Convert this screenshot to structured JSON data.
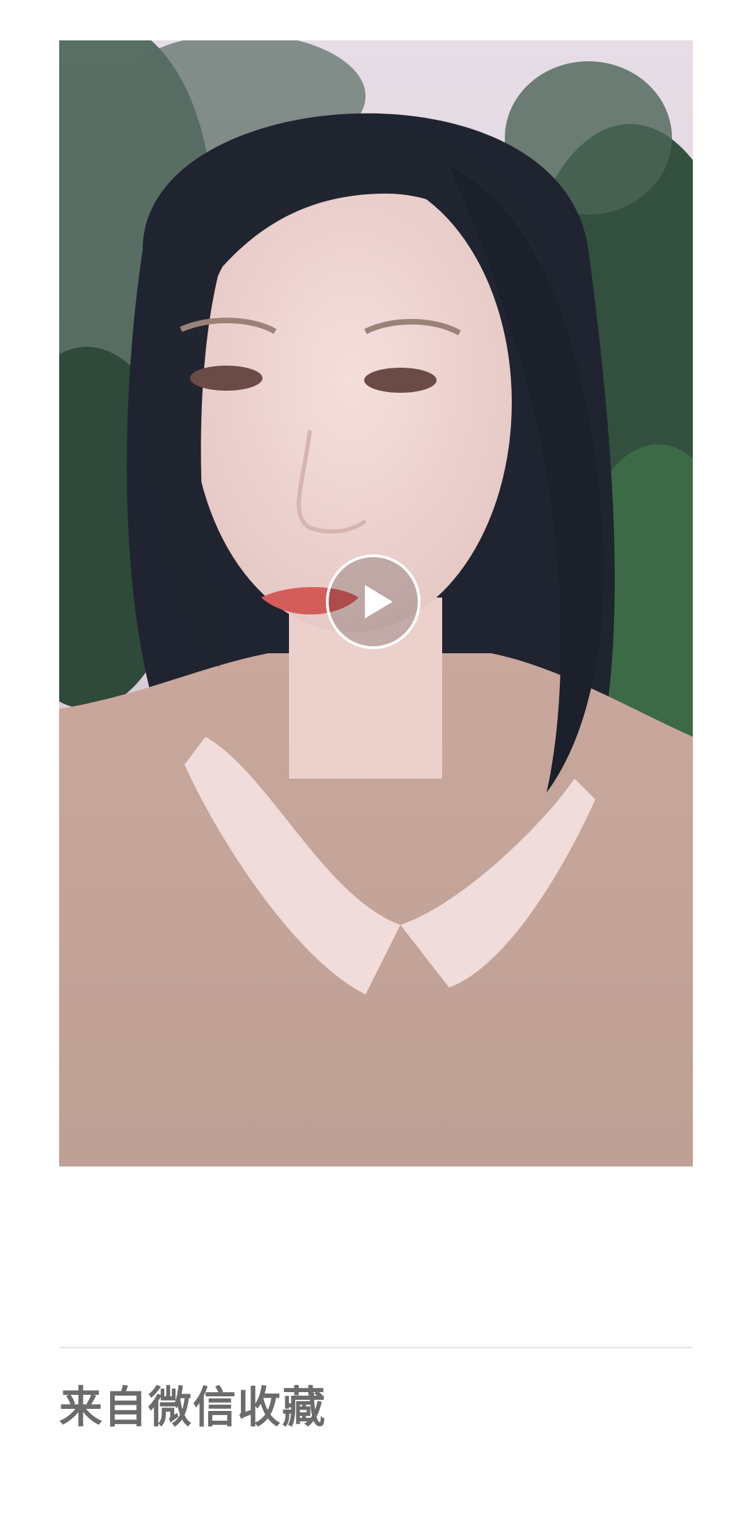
{
  "video": {
    "thumbnail_icon": "video-thumbnail",
    "play_icon": "play-icon"
  },
  "footer": {
    "source_label": "来自微信收藏"
  },
  "colors": {
    "background": "#ffffff",
    "divider": "#e6e6e6",
    "label_text": "#6b6b6b",
    "play_ring": "#ffffff"
  }
}
